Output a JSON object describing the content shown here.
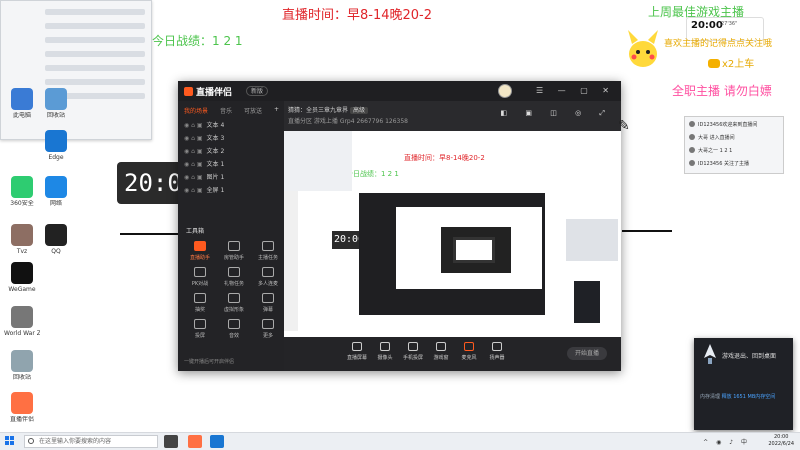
{
  "overlay": {
    "live_time": "直播时间：早8-14晚20-2",
    "today_record": "今日战绩：1 2 1",
    "top_right_green": "上周最佳游戏主播",
    "fulltime_text": "全职主播  请勿白嫖",
    "follow_banner": "喜欢主播的记得点点关注哦",
    "car_text": "x2上车",
    "big_clock": "20:00",
    "promo_time": "20:00",
    "promo_sub": "27'36\""
  },
  "desktop_icons": [
    {
      "label": "此电脑",
      "color": "#3a7bd5"
    },
    {
      "label": "回收站",
      "color": "#5b9bd5"
    },
    {
      "label": "360安全",
      "color": "#2ecc71"
    },
    {
      "label": "网络",
      "color": "#1e88e5"
    },
    {
      "label": "Tvz",
      "color": "#8d6e63"
    },
    {
      "label": "QQ",
      "color": "#222222"
    },
    {
      "label": "WeGame",
      "color": "#111111"
    },
    {
      "label": "World War Z",
      "color": "#777777"
    },
    {
      "label": "回收站",
      "color": "#90a4ae"
    },
    {
      "label": "直播伴侣",
      "color": "#ff7043"
    },
    {
      "label": "Edge",
      "color": "#1976d2"
    }
  ],
  "app": {
    "title": "直播伴侣",
    "version": "新版",
    "left_tabs": [
      "我的场景",
      "音乐",
      "可放送"
    ],
    "scenes": [
      "文本 4",
      "文本 3",
      "文本 2",
      "文本 1",
      "图片 1",
      "全屏 1"
    ],
    "tools_title": "工具箱",
    "tools": [
      {
        "label": "直播助手",
        "hot": true
      },
      {
        "label": "房管助手",
        "hot": false
      },
      {
        "label": "主播任务",
        "hot": false
      },
      {
        "label": "PK对战",
        "hot": false
      },
      {
        "label": "礼物任务",
        "hot": false
      },
      {
        "label": "多人连麦",
        "hot": false
      },
      {
        "label": "抽奖",
        "hot": false
      },
      {
        "label": "虚拟形象",
        "hot": false
      },
      {
        "label": "弹幕",
        "hot": false
      },
      {
        "label": "投屏",
        "hot": false
      },
      {
        "label": "音效",
        "hot": false
      },
      {
        "label": "更多",
        "hot": false
      }
    ],
    "left_footer": "一键开播后可开启伴侣",
    "info_line1": "猜猜：全员三章九章界",
    "info_badge": "高级",
    "info_line2": "直播分区  游戏上播  Grp4  2667796  126358",
    "bottom_tools": [
      "直播屏幕",
      "摄像头",
      "手机投屏",
      "游戏窗",
      "麦克风",
      "扬声器"
    ],
    "start_button": "开始直播"
  },
  "chat": {
    "lines": [
      "ID123456欢迎来到直播间",
      "大哥 进入直播间",
      "大哥之一 1 2 1",
      "ID123456 关注了主播"
    ]
  },
  "notification": {
    "msg1": "游戏退出、回到桌面",
    "msg2": "",
    "footer_label": "内存清理",
    "footer_value": "释放 1651 MB内存空间"
  },
  "taskbar": {
    "search_placeholder": "在这里输入你要搜索的内容",
    "time": "20:00",
    "date": "2022/6/24"
  },
  "colors": {
    "accent": "#ff5a1f",
    "overlay_red": "#e0252a",
    "overlay_green": "#4cc44c",
    "overlay_yellow": "#e7a900"
  }
}
